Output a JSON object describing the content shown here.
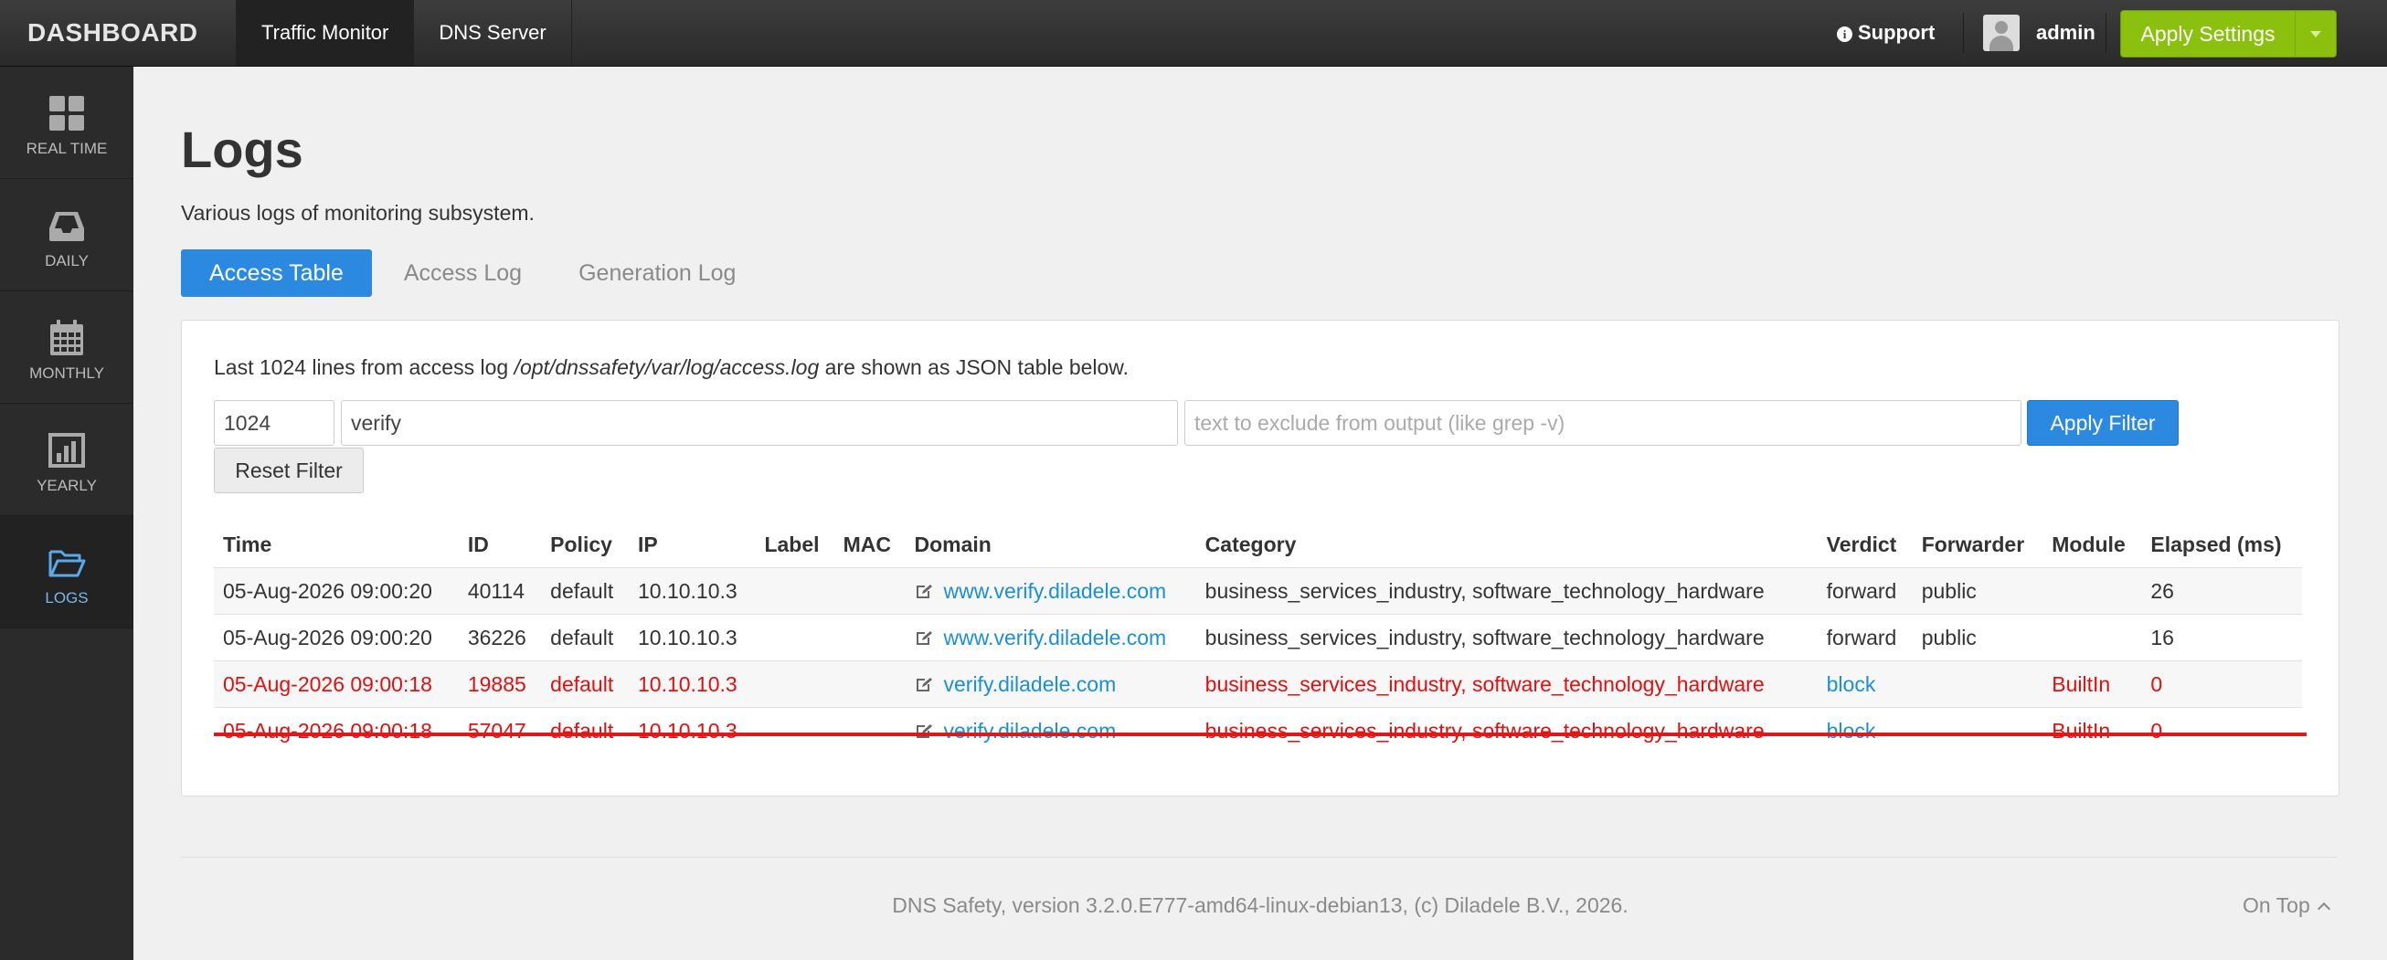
{
  "app": {
    "brand": "DASHBOARD"
  },
  "topnav": {
    "items": [
      {
        "label": "Traffic Monitor",
        "active": true
      },
      {
        "label": "DNS Server",
        "active": false
      }
    ],
    "support_label": "Support",
    "user_name": "admin",
    "apply_label": "Apply Settings",
    "apply_color": "#8cc00e"
  },
  "sidebar": {
    "items": [
      {
        "label": "REAL TIME",
        "icon": "grid-icon"
      },
      {
        "label": "DAILY",
        "icon": "inbox-icon"
      },
      {
        "label": "MONTHLY",
        "icon": "calendar-icon"
      },
      {
        "label": "YEARLY",
        "icon": "bar-chart-icon"
      },
      {
        "label": "LOGS",
        "icon": "folder-open-icon",
        "active": true
      }
    ]
  },
  "page": {
    "title": "Logs",
    "subtitle": "Various logs of monitoring subsystem."
  },
  "tabs": [
    {
      "label": "Access Table",
      "active": true
    },
    {
      "label": "Access Log",
      "active": false
    },
    {
      "label": "Generation Log",
      "active": false
    }
  ],
  "panel": {
    "desc_prefix": "Last 1024 lines from access log ",
    "desc_path": "/opt/dnssafety/var/log/access.log",
    "desc_suffix": " are shown as JSON table below."
  },
  "filter": {
    "lines_value": "1024",
    "include_value": "verify",
    "exclude_placeholder": "text to exclude from output (like grep -v)",
    "apply_label": "Apply Filter",
    "reset_label": "Reset Filter"
  },
  "table": {
    "columns": [
      "Time",
      "ID",
      "Policy",
      "IP",
      "Label",
      "MAC",
      "Domain",
      "Category",
      "Verdict",
      "Forwarder",
      "Module",
      "Elapsed (ms)"
    ],
    "rows": [
      {
        "time": "05-Aug-2026 09:00:20",
        "id": "40114",
        "policy": "default",
        "ip": "10.10.10.3",
        "label": "",
        "mac": "",
        "domain": "www.verify.diladele.com",
        "category": "business_services_industry, software_technology_hardware",
        "verdict": "forward",
        "forwarder": "public",
        "module": "",
        "elapsed": "26",
        "blocked": false
      },
      {
        "time": "05-Aug-2026 09:00:20",
        "id": "36226",
        "policy": "default",
        "ip": "10.10.10.3",
        "label": "",
        "mac": "",
        "domain": "www.verify.diladele.com",
        "category": "business_services_industry, software_technology_hardware",
        "verdict": "forward",
        "forwarder": "public",
        "module": "",
        "elapsed": "16",
        "blocked": false
      },
      {
        "time": "05-Aug-2026 09:00:18",
        "id": "19885",
        "policy": "default",
        "ip": "10.10.10.3",
        "label": "",
        "mac": "",
        "domain": "verify.diladele.com",
        "category": "business_services_industry, software_technology_hardware",
        "verdict": "block",
        "forwarder": "",
        "module": "BuiltIn",
        "elapsed": "0",
        "blocked": true
      },
      {
        "time": "05-Aug-2026 09:00:18",
        "id": "57047",
        "policy": "default",
        "ip": "10.10.10.3",
        "label": "",
        "mac": "",
        "domain": "verify.diladele.com",
        "category": "business_services_industry, software_technology_hardware",
        "verdict": "block",
        "forwarder": "",
        "module": "BuiltIn",
        "elapsed": "0",
        "blocked": true
      }
    ],
    "blocked_color": "#e01010",
    "link_color": "#1a8fd3"
  },
  "footer": {
    "text": "DNS Safety, version 3.2.0.E777-amd64-linux-debian13, (c) Diladele B.V., 2026.",
    "on_top_label": "On Top"
  }
}
